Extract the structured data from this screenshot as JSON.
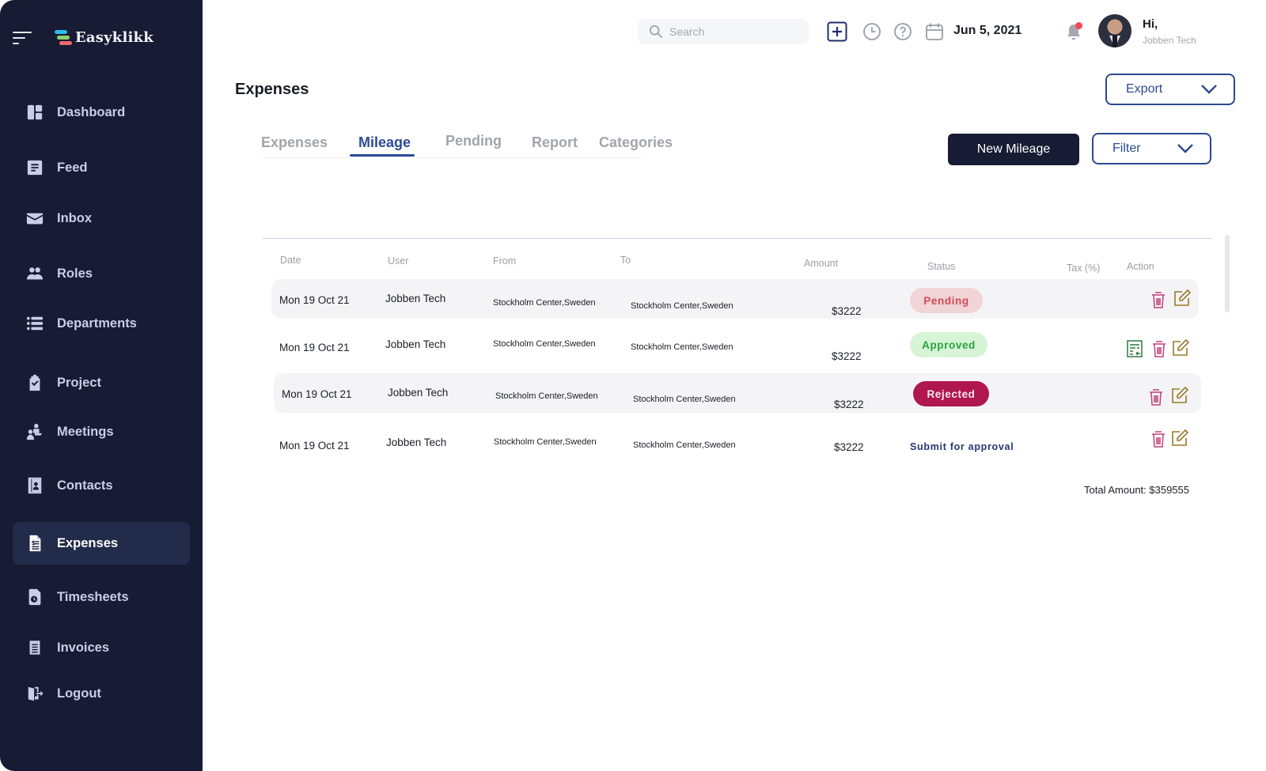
{
  "app": {
    "name": "Easyklikk",
    "logo_colors": [
      "#2cbcea",
      "#8fd46a",
      "#ea6a6a"
    ]
  },
  "sidebar": {
    "items": [
      {
        "label": "Dashboard",
        "icon": "dashboard-icon",
        "active": false
      },
      {
        "label": "Feed",
        "icon": "feed-icon",
        "active": false
      },
      {
        "label": "Inbox",
        "icon": "inbox-icon",
        "active": false
      },
      {
        "label": "Roles",
        "icon": "roles-icon",
        "active": false
      },
      {
        "label": "Departments",
        "icon": "departments-icon",
        "active": false
      },
      {
        "label": "Project",
        "icon": "project-icon",
        "active": false
      },
      {
        "label": "Meetings",
        "icon": "meetings-icon",
        "active": false
      },
      {
        "label": "Contacts",
        "icon": "contacts-icon",
        "active": false
      },
      {
        "label": "Expenses",
        "icon": "expenses-icon",
        "active": true
      },
      {
        "label": "Timesheets",
        "icon": "timesheets-icon",
        "active": false
      },
      {
        "label": "Invoices",
        "icon": "invoices-icon",
        "active": false
      },
      {
        "label": "Logout",
        "icon": "logout-icon",
        "active": false
      }
    ]
  },
  "topbar": {
    "search_placeholder": "Search",
    "date": "Jun 5, 2021",
    "greeting": "Hi,",
    "user_name": "Jobben Tech",
    "has_notification": true
  },
  "page": {
    "title": "Expenses",
    "export_label": "Export",
    "new_button_label": "New Mileage",
    "filter_label": "Filter",
    "tabs": [
      {
        "label": "Expenses",
        "active": false
      },
      {
        "label": "Mileage",
        "active": true
      },
      {
        "label": "Pending",
        "active": false
      },
      {
        "label": "Report",
        "active": false
      },
      {
        "label": "Categories",
        "active": false
      }
    ]
  },
  "table": {
    "columns": [
      "Date",
      "User",
      "From",
      "To",
      "Amount",
      "Status",
      "Tax (%)",
      "Action"
    ],
    "rows": [
      {
        "date": "Mon 19 Oct 21",
        "user": "Jobben Tech",
        "from": "Stockholm Center,Sweden",
        "to": "Stockholm Center,Sweden",
        "amount": "$3222",
        "status": "Pending",
        "status_type": "pending",
        "tax": "",
        "actions": [
          "delete",
          "edit"
        ]
      },
      {
        "date": "Mon 19 Oct 21",
        "user": "Jobben Tech",
        "from": "Stockholm Center,Sweden",
        "to": "Stockholm Center,Sweden",
        "amount": "$3222",
        "status": "Approved",
        "status_type": "approved",
        "tax": "",
        "actions": [
          "report",
          "delete",
          "edit"
        ]
      },
      {
        "date": "Mon 19 Oct 21",
        "user": "Jobben Tech",
        "from": "Stockholm Center,Sweden",
        "to": "Stockholm Center,Sweden",
        "amount": "$3222",
        "status": "Rejected",
        "status_type": "rejected",
        "tax": "",
        "actions": [
          "delete",
          "edit"
        ]
      },
      {
        "date": "Mon 19 Oct 21",
        "user": "Jobben Tech",
        "from": "Stockholm Center,Sweden",
        "to": "Stockholm Center,Sweden",
        "amount": "$3222",
        "status": "Submit for approval",
        "status_type": "submit",
        "tax": "",
        "actions": [
          "delete",
          "edit"
        ]
      }
    ],
    "total_label": "Total Amount: $359555"
  },
  "colors": {
    "sidebar_bg": "#171b33",
    "accent": "#2b4a9a",
    "pending": "#cf4a5a",
    "approved": "#2aa13e",
    "rejected": "#b0174f",
    "delete_icon": "#c0407a",
    "edit_icon": "#9a7a2a",
    "report_icon": "#2f7a40"
  }
}
